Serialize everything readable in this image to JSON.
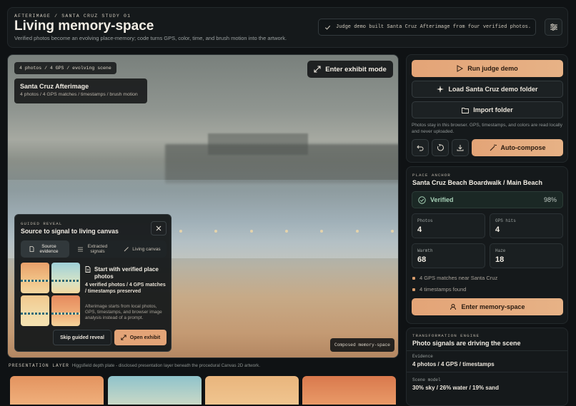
{
  "header": {
    "eyebrow": "AFTERIMAGE / SANTA CRUZ STUDY 01",
    "title": "Living memory-space",
    "subtitle": "Verified photos become an evolving place-memory; code turns GPS, color, time, and brush motion into the artwork.",
    "status": "Judge demo built Santa Cruz Afterimage from four verified photos."
  },
  "stage": {
    "chip": "4 photos / 4 GPS / evolving scene",
    "card_title": "Santa Cruz Afterimage",
    "card_sub": "4 photos / 4 GPS matches / timestamps / brush motion",
    "exhibit_label": "Enter exhibit mode",
    "composed_label": "Composed memory-space"
  },
  "guide": {
    "eyebrow": "GUIDED REVEAL",
    "title": "Source to signal to living canvas",
    "tabs": [
      {
        "label": "Source evidence"
      },
      {
        "label": "Extracted signals"
      },
      {
        "label": "Living canvas"
      }
    ],
    "step_title": "Start with verified place photos",
    "step_strong": "4 verified photos / 4 GPS matches / timestamps preserved",
    "step_body": "Afterimage starts from local photos, GPS, timestamps, and browser image analysis instead of a prompt.",
    "skip_label": "Skip guided reveal",
    "open_label": "Open exhibit"
  },
  "presentation": {
    "eyebrow": "PRESENTATION LAYER",
    "text": "Higgsfield depth plate - disclosed presentation layer beneath the procedural Canvas 2D artwork."
  },
  "actions": {
    "run_demo": "Run judge demo",
    "load_demo": "Load Santa Cruz demo folder",
    "import": "Import folder",
    "note": "Photos stay in this browser. GPS, timestamps, and colors are read locally and never uploaded.",
    "auto_compose": "Auto-compose"
  },
  "place": {
    "eyebrow": "PLACE ANCHOR",
    "title": "Santa Cruz Beach Boardwalk / Main Beach",
    "verified_label": "Verified",
    "verified_pct": "98%",
    "stats": [
      {
        "key": "Photos",
        "value": "4"
      },
      {
        "key": "GPS hits",
        "value": "4"
      },
      {
        "key": "Warmth",
        "value": "68"
      },
      {
        "key": "Haze",
        "value": "18"
      }
    ],
    "bullets": [
      "4 GPS matches near Santa Cruz",
      "4 timestamps found"
    ],
    "enter_label": "Enter memory-space"
  },
  "engine": {
    "eyebrow": "TRANSFORMATION ENGINE",
    "title": "Photo signals are driving the scene",
    "evidence_key": "Evidence",
    "evidence_value": "4 photos / 4 GPS / timestamps",
    "scene_key": "Scene model",
    "scene_value": "30% sky / 26% water / 19% sand"
  },
  "colors": {
    "accent": "#e3a477",
    "verified": "#a6d1b7",
    "background": "#0f1214"
  }
}
